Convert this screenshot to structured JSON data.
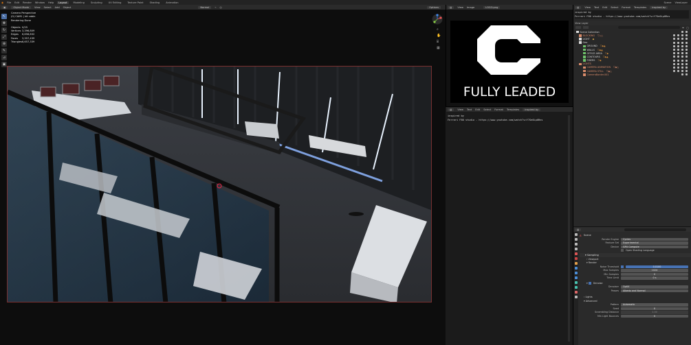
{
  "topbar": {
    "menus": [
      "File",
      "Edit",
      "Render",
      "Window",
      "Help"
    ],
    "workspaces": [
      "Layout",
      "Modeling",
      "Sculpting",
      "UV Editing",
      "Texture Paint",
      "Shading",
      "Animation"
    ],
    "active_workspace": "Layout",
    "scene": "Scene",
    "view_layer": "ViewLayer"
  },
  "viewport": {
    "mode": "Object Mode",
    "menus": [
      "View",
      "Select",
      "Add",
      "Object"
    ],
    "orientation": "Normal",
    "options": "Options",
    "stats": {
      "title": "Camera Perspective",
      "subtitle": "(0) CAM1 | kit cabin",
      "state": "Rendering Done",
      "rows": [
        {
          "label": "Objects",
          "value": "0/25"
        },
        {
          "label": "Vertices",
          "value": "3,396,809"
        },
        {
          "label": "Edges",
          "value": "6,656,832"
        },
        {
          "label": "Faces",
          "value": "3,357,439"
        },
        {
          "label": "Triangles",
          "value": "6,657,339"
        }
      ]
    },
    "tools": [
      "cursor",
      "move",
      "rotate",
      "scale",
      "transform",
      "annotate",
      "measure",
      "add"
    ]
  },
  "image_editor": {
    "menus": [
      "View",
      "Image"
    ],
    "image_name": "LOGO.png",
    "logo_text": "FULLY LEADED"
  },
  "text_editor": {
    "menus": [
      "View",
      "Text",
      "Edit",
      "Select",
      "Format",
      "Templates"
    ],
    "file": "inspired by",
    "lines": [
      "inspired by",
      "Ferrari F80 studio - https://www.youtube.com/watch?v=Y7Ge0Lp0Rns"
    ]
  },
  "outliner_text": {
    "menus": [
      "View",
      "Text",
      "Edit",
      "Select",
      "Format",
      "Templates"
    ],
    "file": "inspired by",
    "lines": [
      "inspired by",
      "Ferrari F80 studio - https://www.youtube.com/watch?v=Y7Ge0Lp0Rns"
    ]
  },
  "outliner": {
    "display": "View Layer",
    "items": [
      {
        "name": "Scene Collection",
        "depth": 0,
        "color": "#d8d8d8"
      },
      {
        "name": "BLOCKING",
        "depth": 1,
        "color": "#d98b6a"
      },
      {
        "name": "LIGHT",
        "depth": 1,
        "color": "#d8d8d8"
      },
      {
        "name": "Geo",
        "depth": 1,
        "color": "#d8d8d8"
      },
      {
        "name": "GROUND",
        "depth": 2,
        "color": "#d8d8d8"
      },
      {
        "name": "WALLS",
        "depth": 2,
        "color": "#d8d8d8"
      },
      {
        "name": "OFFICE AREA",
        "depth": 2,
        "color": "#d8d8d8"
      },
      {
        "name": "CONTOURS",
        "depth": 2,
        "color": "#d8d8d8"
      },
      {
        "name": "FIBERS",
        "depth": 2,
        "color": "#d8d8d8"
      },
      {
        "name": "LIGHTS",
        "depth": 1,
        "color": "#d98b6a"
      },
      {
        "name": "CAMERA ANIMATION",
        "depth": 2,
        "color": "#d98b6a"
      },
      {
        "name": "CAMERA STILL",
        "depth": 2,
        "color": "#d98b6a"
      },
      {
        "name": "CameraBorder.001",
        "depth": 2,
        "color": "#d98b6a"
      }
    ]
  },
  "properties": {
    "context": "Scene",
    "rows": [
      {
        "label": "Render Engine",
        "value": "Cycles"
      },
      {
        "label": "Feature Set",
        "value": "Experimental"
      },
      {
        "label": "Device",
        "value": "GPU Compute"
      }
    ],
    "osl": "Open Shading Language",
    "sampling": "Sampling",
    "viewport": "Viewport",
    "render": "Render",
    "noise_rows": [
      {
        "label": "Noise Threshold",
        "value": "0.0100"
      },
      {
        "label": "Max Samples",
        "value": "1024"
      },
      {
        "label": "Min Samples",
        "value": "0"
      },
      {
        "label": "Time Limit",
        "value": "0 s"
      }
    ],
    "denoise": "Denoise",
    "denoise_rows": [
      {
        "label": "Denoiser",
        "value": "OptiX"
      },
      {
        "label": "Passes",
        "value": "Albedo and Normal"
      }
    ],
    "lights": "Lights",
    "advanced": "Advanced",
    "adv_rows": [
      {
        "label": "Pattern",
        "value": "Automatic"
      },
      {
        "label": "Seed",
        "value": "0"
      },
      {
        "label": "Scrambling Distance",
        "value": "1.00"
      },
      {
        "label": "Min Light Bounces",
        "value": "0"
      }
    ]
  }
}
